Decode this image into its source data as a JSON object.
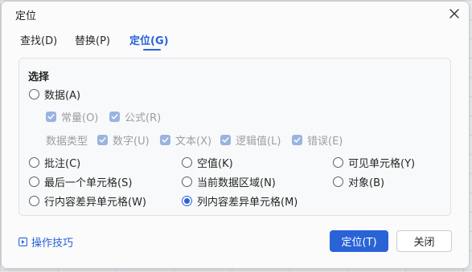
{
  "dialog": {
    "title": "定位",
    "close_icon": "close-icon"
  },
  "tabs": [
    {
      "label": "查找(D)",
      "active": false
    },
    {
      "label": "替换(P)",
      "active": false
    },
    {
      "label": "定位(G)",
      "active": true
    }
  ],
  "select_section": {
    "title": "选择",
    "data_radio": {
      "label": "数据(A)",
      "checked": false
    },
    "constant": {
      "label": "常量(O)",
      "checked": true,
      "disabled": true
    },
    "formula": {
      "label": "公式(R)",
      "checked": true,
      "disabled": true
    },
    "data_type_label": "数据类型",
    "number": {
      "label": "数字(U)",
      "checked": true,
      "disabled": true
    },
    "text": {
      "label": "文本(X)",
      "checked": true,
      "disabled": true
    },
    "logical": {
      "label": "逻辑值(L)",
      "checked": true,
      "disabled": true
    },
    "error": {
      "label": "错误(E)",
      "checked": true,
      "disabled": true
    },
    "options": [
      {
        "label": "批注(C)",
        "checked": false
      },
      {
        "label": "空值(K)",
        "checked": false
      },
      {
        "label": "可见单元格(Y)",
        "checked": false
      },
      {
        "label": "最后一个单元格(S)",
        "checked": false
      },
      {
        "label": "当前数据区域(N)",
        "checked": false
      },
      {
        "label": "对象(B)",
        "checked": false
      },
      {
        "label": "行内容差异单元格(W)",
        "checked": false
      },
      {
        "label": "列内容差异单元格(M)",
        "checked": true
      }
    ]
  },
  "footer": {
    "tips_label": "操作技巧",
    "tips_icon": "play-square-icon",
    "ok_label": "定位(T)",
    "cancel_label": "关闭"
  },
  "colors": {
    "accent": "#2a63d6",
    "disabled_check": "#9ab3e0"
  }
}
